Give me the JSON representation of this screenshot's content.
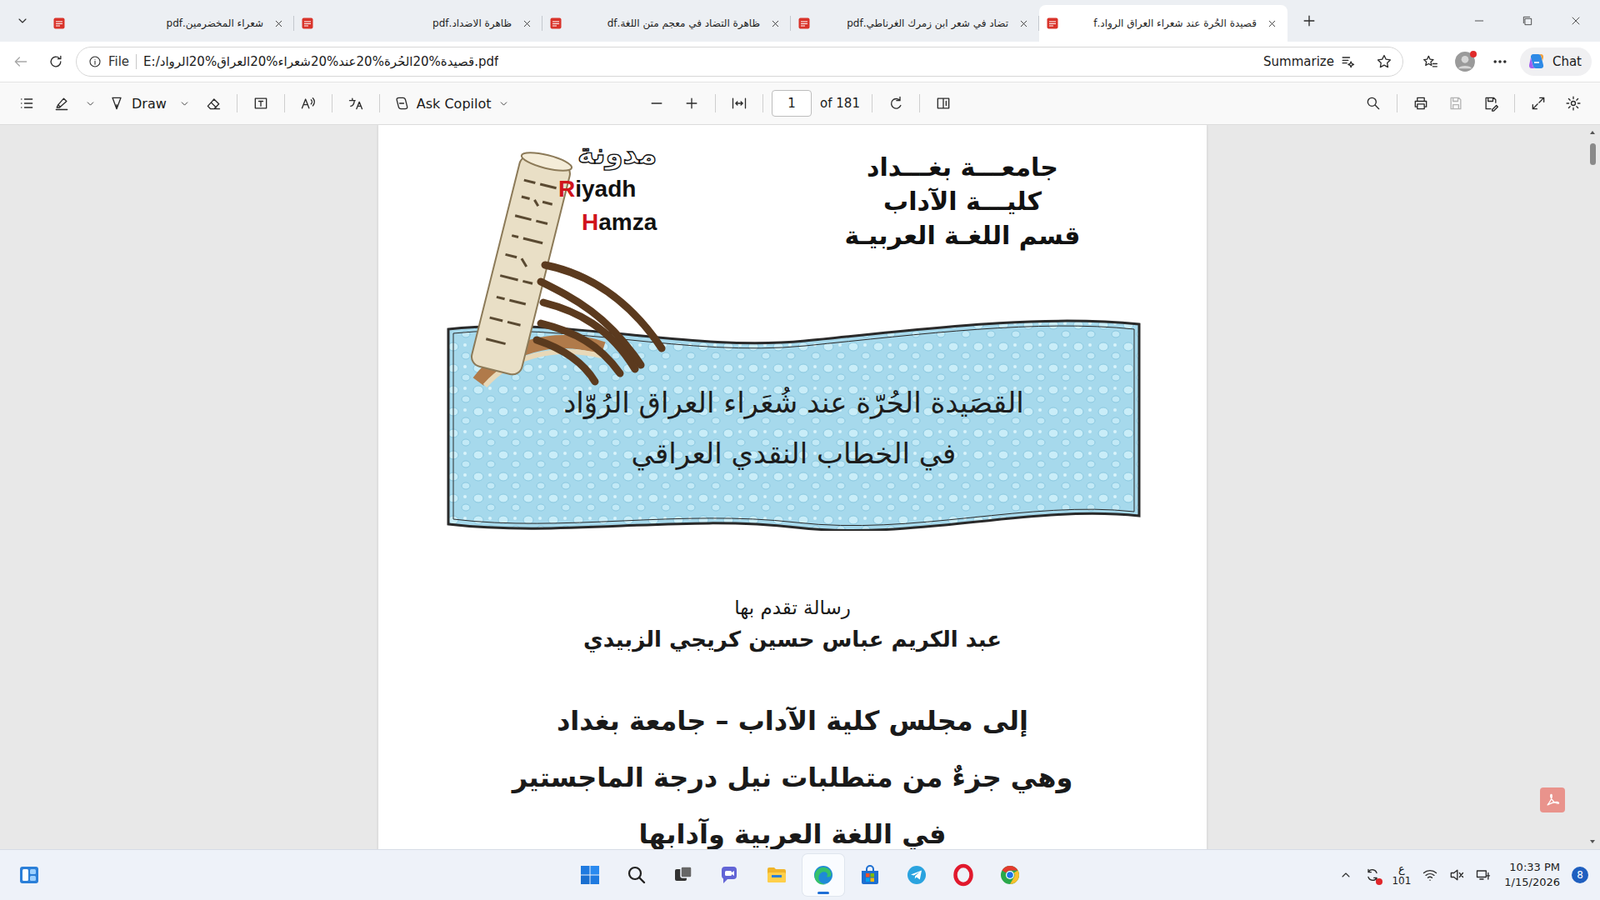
{
  "tabs": [
    {
      "label": "شعراء المخضرمين.pdf",
      "selected": false
    },
    {
      "label": "ظاهرة الاضداد.pdf",
      "selected": false
    },
    {
      "label": "ظاهرة التضاد في معجم متن اللغة.df",
      "selected": false
    },
    {
      "label": "تضاد في شعر ابن زمرك الغرناطي.pdf",
      "selected": false
    },
    {
      "label": "قصيدة الحُرة عند شعراء العراق الرواد.f",
      "selected": true
    }
  ],
  "address_bar": {
    "scheme": "File",
    "url": "E:/قصيدة%20الحُرة%20عند%20شعراء%20العراق%20الرواد.pdf",
    "summarize": "Summarize",
    "chat": "Chat",
    "back_disabled": true,
    "profile_alert": true
  },
  "pdf_toolbar": {
    "draw": "Draw",
    "ask_copilot": "Ask Copilot",
    "page": "1",
    "page_total": "of 181",
    "save_disabled": true
  },
  "document": {
    "blog_label": "مدونة",
    "logo_line1": "Riyadh",
    "logo_line2": "Hamza",
    "institution": [
      "جامعـــة بغـــداد",
      "كليـــة الآداب",
      "قسم اللغـة العربيـة"
    ],
    "title": [
      "القصَيدة الحُرّة عند شُعَراء العراق الرُوّاد",
      "في الخطاب النقدي العراقي"
    ],
    "submitted_by": "رسالة تقدم بها",
    "author": "عبد الكريم عباس حسين كريجي الزبيدي",
    "lines": [
      "إلى مجلس كلية الآداب – جامعة بغداد",
      "وهي جزءٌ من متطلبات نيل درجة الماجستير",
      "في اللغة العربية وآدابها"
    ]
  },
  "taskbar": {
    "apps": [
      {
        "kind": "start",
        "active": false
      },
      {
        "kind": "search",
        "active": false
      },
      {
        "kind": "taskview",
        "active": false
      },
      {
        "kind": "meet",
        "active": false
      },
      {
        "kind": "explorer",
        "active": false
      },
      {
        "kind": "edge",
        "active": true
      },
      {
        "kind": "store",
        "active": false
      },
      {
        "kind": "telegram",
        "active": false
      },
      {
        "kind": "opera",
        "active": false
      },
      {
        "kind": "chrome",
        "active": false
      }
    ],
    "tray": {
      "input_language": "ع",
      "input_code": "101",
      "time": "10:33 PM",
      "date": "1/15/2026",
      "notification_count": "8",
      "sync_alert": true
    }
  }
}
